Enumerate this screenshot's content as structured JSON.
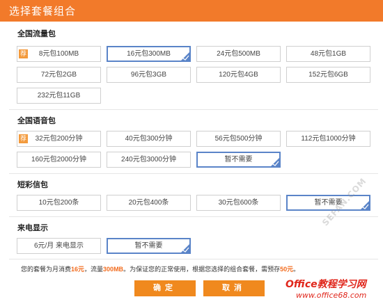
{
  "dialog": {
    "title": "选择套餐组合"
  },
  "data_plan": {
    "title": "全国流量包",
    "badge": "荐",
    "options": [
      "8元包100MB",
      "16元包300MB",
      "24元包500MB",
      "48元包1GB",
      "72元包2GB",
      "96元包3GB",
      "120元包4GB",
      "152元包6GB",
      "232元包11GB"
    ],
    "selected": "16元包300MB"
  },
  "voice_plan": {
    "title": "全国语音包",
    "badge": "荐",
    "options": [
      "32元包200分钟",
      "40元包300分钟",
      "56元包500分钟",
      "112元包1000分钟",
      "160元包2000分钟",
      "240元包3000分钟",
      "暂不需要"
    ],
    "selected": "暂不需要"
  },
  "sms_plan": {
    "title": "短彩信包",
    "options": [
      "10元包200条",
      "20元包400条",
      "30元包600条",
      "暂不需要"
    ],
    "selected": "暂不需要"
  },
  "caller_id": {
    "title": "来电显示",
    "options": [
      "6元/月 来电显示",
      "暂不需要"
    ],
    "selected": "暂不需要"
  },
  "summary": {
    "p1": "您的套餐为月消费",
    "monthly": "16元",
    "p2": "，流量",
    "traffic": "300MB",
    "p3": "。为保证您的正常使用，根据您选择的组合套餐，需预存",
    "prepay": "50元",
    "p4": "。"
  },
  "buttons": {
    "confirm": "确定",
    "cancel": "取消"
  },
  "watermark": {
    "site_line1": "Office教程学习网",
    "site_line2": "www.office68.com",
    "diag": "SEFAN.COM",
    "brand_color": "#e0261b"
  },
  "colors": {
    "title_bar": "#f27a2a",
    "selected_border": "#5a84c8",
    "button": "#f0891e",
    "highlight": "#f26b1d"
  }
}
